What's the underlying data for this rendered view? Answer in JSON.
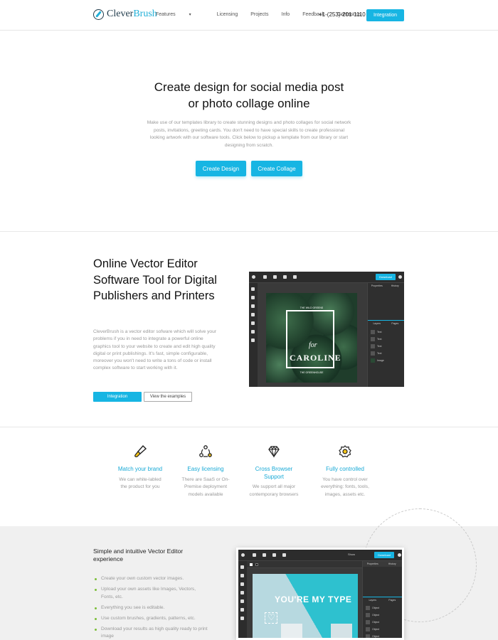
{
  "header": {
    "logo_left": "Clever",
    "logo_right": "Brush",
    "nav": [
      "Features",
      "Licensing",
      "Projects",
      "Info",
      "Feedback",
      "Contact us"
    ],
    "phone": "+1-(253)-201-1110",
    "integration_label": "Integration"
  },
  "hero": {
    "title_line1": "Create design for social media post",
    "title_line2": "or photo collage online",
    "description": "Make use of our templates library to create stunning designs and photo collages for social network posts, invitations, greeting cards. You don't need to have special skills to create professional looking artwork with our software tools. Click below to pickup a template from our library or start designing from scratch.",
    "btn_design": "Create Design",
    "btn_collage": "Create Collage"
  },
  "editor_section": {
    "title": "Online Vector Editor Software Tool for Digital Publishers and Printers",
    "description": "CleverBrush is a vector editor sofware which will solve your problems if you in need to integrate a powerful online graphics tool to your website to create and edit high quality digital or print publishings. It's fast, simple configurable, moreover you won't need to write a tons of code or install complex software to start working with it.",
    "btn_integration": "Integration",
    "btn_examples": "View the examples",
    "mockup": {
      "download_label": "Download",
      "tab_properties": "Properties",
      "tab_history": "History",
      "tab_layers": "Layers",
      "tab_pages": "Pages",
      "layers": [
        "Text",
        "Text",
        "Text",
        "Text",
        "Image"
      ],
      "canvas_small_text": "THE WILD GREENS",
      "canvas_for": "for",
      "canvas_name": "CAROLINE",
      "canvas_sub": "THE GREENHOUSE"
    }
  },
  "features": [
    {
      "icon": "brush-icon",
      "title": "Match your brand",
      "desc": "We can white-labled the product for you"
    },
    {
      "icon": "network-icon",
      "title": "Easy licensing",
      "desc": "There are SaaS or On-Premise deployment models available"
    },
    {
      "icon": "diamond-icon",
      "title": "Cross Browser Support",
      "desc": "We support all major contemporary browsers"
    },
    {
      "icon": "gear-icon",
      "title": "Fully controlled",
      "desc": "You have control over everything: fonts, tools, images, assets etc."
    }
  ],
  "simple_section": {
    "title": "Simple and intuitive Vector Editor experience",
    "bullets": [
      "Create your own custom vector images.",
      "Upload your own assets like Images, Vectors, Fonts, etc.",
      "Everything you see is editable.",
      "Use custom brushes, gradients, patterns, etc.",
      "Download your results as high quality ready to print image"
    ],
    "mockup": {
      "download_label": "Download",
      "show_label": "Show",
      "tab_properties": "Properties",
      "tab_history": "History",
      "tab_layers": "Layers",
      "tab_pages": "Pages",
      "layers": [
        "Object",
        "Object",
        "Object",
        "Object",
        "Object"
      ],
      "headline": "YOU'RE MY TYPE"
    }
  },
  "colors": {
    "accent": "#17b5e3",
    "feature_title": "#17a9d6",
    "bullet": "#7cbf3a"
  }
}
